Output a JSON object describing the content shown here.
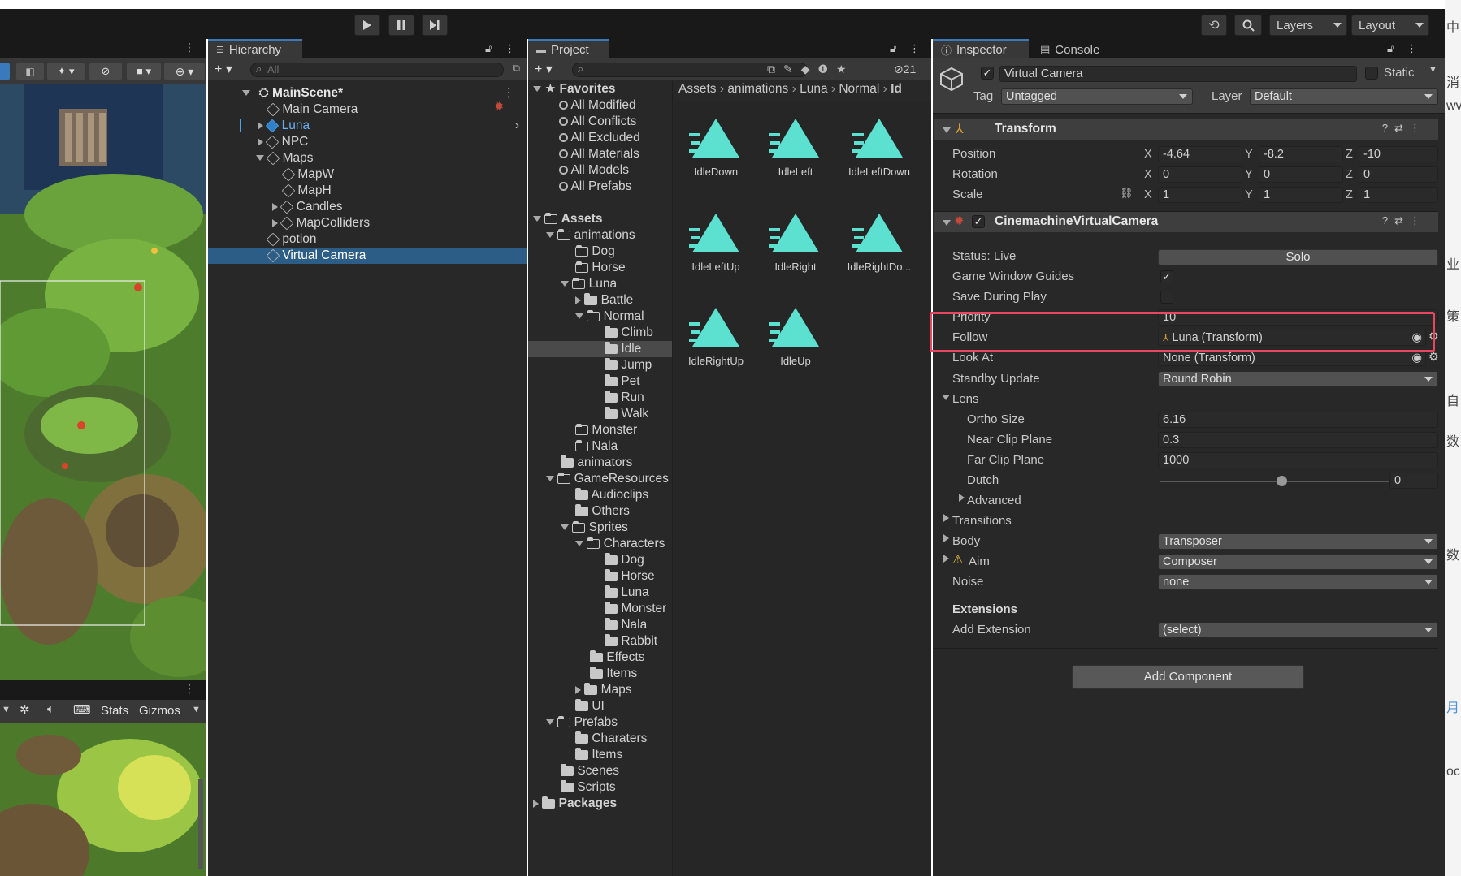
{
  "toolbar": {
    "play_icon": "play-icon",
    "pause_icon": "pause-icon",
    "step_icon": "step-icon",
    "layers_label": "Layers",
    "layout_label": "Layout"
  },
  "scene_toolbar": {
    "stats_label": "Stats",
    "gizmos_label": "Gizmos"
  },
  "hierarchy": {
    "tab": "Hierarchy",
    "search_placeholder": "All",
    "items": [
      {
        "label": "MainScene*"
      },
      {
        "label": "Main Camera"
      },
      {
        "label": "Luna"
      },
      {
        "label": "NPC"
      },
      {
        "label": "Maps"
      },
      {
        "label": "MapW"
      },
      {
        "label": "MapH"
      },
      {
        "label": "Candles"
      },
      {
        "label": "MapColliders"
      },
      {
        "label": "potion"
      },
      {
        "label": "Virtual Camera"
      }
    ]
  },
  "project": {
    "tab": "Project",
    "hidden_count": "21",
    "breadcrumb": [
      "Assets",
      "animations",
      "Luna",
      "Normal",
      "Id"
    ],
    "favorites_title": "Favorites",
    "favorites": [
      "All Modified",
      "All Conflicts",
      "All Excluded",
      "All Materials",
      "All Models",
      "All Prefabs"
    ],
    "tree": [
      {
        "label": "Assets"
      },
      {
        "label": "animations"
      },
      {
        "label": "Dog"
      },
      {
        "label": "Horse"
      },
      {
        "label": "Luna"
      },
      {
        "label": "Battle"
      },
      {
        "label": "Normal"
      },
      {
        "label": "Climb"
      },
      {
        "label": "Idle"
      },
      {
        "label": "Jump"
      },
      {
        "label": "Pet"
      },
      {
        "label": "Run"
      },
      {
        "label": "Walk"
      },
      {
        "label": "Monster"
      },
      {
        "label": "Nala"
      },
      {
        "label": "animators"
      },
      {
        "label": "GameResources"
      },
      {
        "label": "Audioclips"
      },
      {
        "label": "Others"
      },
      {
        "label": "Sprites"
      },
      {
        "label": "Characters"
      },
      {
        "label": "Dog"
      },
      {
        "label": "Horse"
      },
      {
        "label": "Luna"
      },
      {
        "label": "Monster"
      },
      {
        "label": "Nala"
      },
      {
        "label": "Rabbit"
      },
      {
        "label": "Effects"
      },
      {
        "label": "Items"
      },
      {
        "label": "Maps"
      },
      {
        "label": "UI"
      },
      {
        "label": "Prefabs"
      },
      {
        "label": "Charaters"
      },
      {
        "label": "Items"
      },
      {
        "label": "Scenes"
      },
      {
        "label": "Scripts"
      },
      {
        "label": "Packages"
      }
    ],
    "assets": [
      "IdleDown",
      "IdleLeft",
      "IdleLeftDown",
      "IdleLeftUp",
      "IdleRight",
      "IdleRightDo...",
      "IdleRightUp",
      "IdleUp"
    ],
    "asset_icon": "animation-clip-icon",
    "asset_color": "#5ce0d0"
  },
  "inspector": {
    "tab": "Inspector",
    "console_tab": "Console",
    "object_name": "Virtual Camera",
    "static_label": "Static",
    "tag_label": "Tag",
    "tag_value": "Untagged",
    "layer_label": "Layer",
    "layer_value": "Default",
    "transform": {
      "title": "Transform",
      "position": {
        "label": "Position",
        "x": "-4.64",
        "y": "-8.2",
        "z": "-10"
      },
      "rotation": {
        "label": "Rotation",
        "x": "0",
        "y": "0",
        "z": "0"
      },
      "scale": {
        "label": "Scale",
        "x": "1",
        "y": "1",
        "z": "1"
      },
      "axis_x": "X",
      "axis_y": "Y",
      "axis_z": "Z"
    },
    "vcam": {
      "title": "CinemachineVirtualCamera",
      "status_label": "Status: Live",
      "solo_label": "Solo",
      "guides_label": "Game Window Guides",
      "save_label": "Save During Play",
      "priority_label": "Priority",
      "priority_value": "10",
      "follow_label": "Follow",
      "follow_value": "Luna (Transform)",
      "lookat_label": "Look At",
      "lookat_value": "None (Transform)",
      "standby_label": "Standby Update",
      "standby_value": "Round Robin",
      "lens_label": "Lens",
      "ortho_label": "Ortho Size",
      "ortho_value": "6.16",
      "near_label": "Near Clip Plane",
      "near_value": "0.3",
      "far_label": "Far Clip Plane",
      "far_value": "1000",
      "dutch_label": "Dutch",
      "dutch_value": "0",
      "dutch_fraction": 0.5,
      "advanced_label": "Advanced",
      "transitions_label": "Transitions",
      "body_label": "Body",
      "body_value": "Transposer",
      "aim_label": "Aim",
      "aim_value": "Composer",
      "noise_label": "Noise",
      "noise_value": "none",
      "extensions_title": "Extensions",
      "add_ext_label": "Add Extension",
      "add_ext_value": "(select)"
    },
    "add_component_label": "Add Component"
  },
  "right_edge_text": [
    "中",
    "消",
    "wv",
    "业",
    "策",
    "自",
    "数",
    "数",
    "月",
    "oc"
  ],
  "colors": {
    "highlight": "#e8475f",
    "selection": "#2c5d87",
    "tab_accent": "#3a79bb"
  }
}
